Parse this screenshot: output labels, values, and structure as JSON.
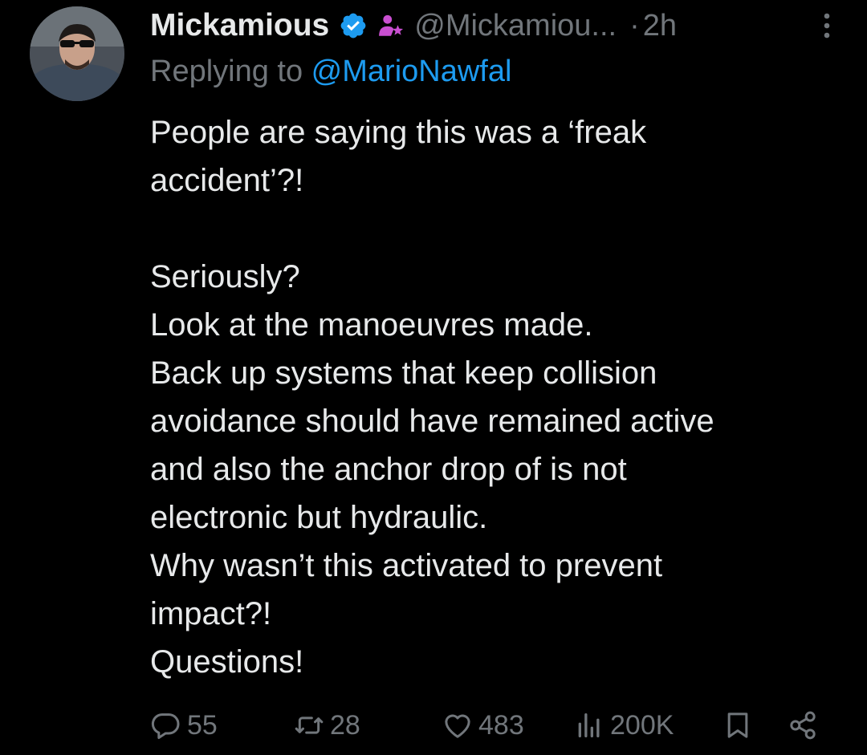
{
  "tweet": {
    "author_name": "Mickamious",
    "handle": "@Mickamiou...",
    "separator": "·",
    "time": "2h",
    "reply_prefix": "Replying to ",
    "reply_mention": "@MarioNawfal",
    "lines": [
      "People are saying this was a ‘freak",
      "accident’?!",
      "",
      "Seriously?",
      "Look at the manoeuvres made.",
      "Back up systems that keep collision",
      "avoidance should have remained active",
      "and also the anchor drop of is not",
      "electronic but hydraulic.",
      "Why wasn’t this activated to prevent",
      "impact?!",
      "Questions!"
    ]
  },
  "actions": {
    "replies": "55",
    "reposts": "28",
    "likes": "483",
    "views": "200K"
  },
  "icons": {
    "verified": "verified-badge-icon",
    "affiliate": "affiliate-person-icon",
    "more": "more-vertical-icon",
    "reply": "reply-icon",
    "repost": "repost-icon",
    "like": "heart-icon",
    "views": "views-chart-icon",
    "bookmark": "bookmark-icon",
    "share": "share-icon"
  },
  "colors": {
    "background": "#000000",
    "text": "#e7e9ea",
    "muted": "#71767b",
    "link": "#1d9bf0",
    "verified": "#1d9bf0",
    "affiliate": "#c94fd1"
  }
}
